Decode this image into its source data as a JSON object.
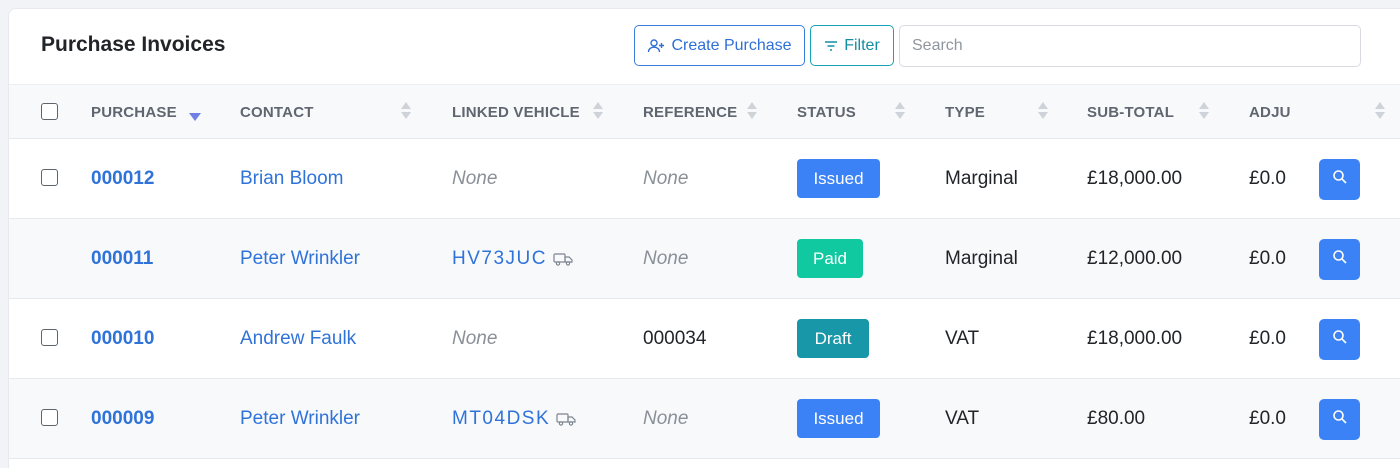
{
  "header": {
    "title": "Purchase Invoices",
    "create_label": "Create Purchase",
    "filter_label": "Filter",
    "search_placeholder": "Search"
  },
  "columns": {
    "purchase": "PURCHASE",
    "contact": "CONTACT",
    "linked_vehicle": "LINKED VEHICLE",
    "reference": "REFERENCE",
    "status": "STATUS",
    "type": "TYPE",
    "subtotal": "SUB-TOTAL",
    "adjustment": "ADJU"
  },
  "sort": {
    "column": "purchase",
    "direction": "desc"
  },
  "colors": {
    "accent": "#3b82f6",
    "link": "#2f73d9",
    "status_issued": "#3b82f6",
    "status_paid": "#10c9a0",
    "status_draft": "#1797a8"
  },
  "rows": [
    {
      "purchase": "000012",
      "contact": "Brian Bloom",
      "vehicle": "None",
      "vehicle_linked": false,
      "reference": "None",
      "reference_set": false,
      "status": "Issued",
      "type": "Marginal",
      "subtotal": "£18,000.00",
      "adjustment": "£0.0",
      "has_checkbox": true
    },
    {
      "purchase": "000011",
      "contact": "Peter Wrinkler",
      "vehicle": "HV73JUC",
      "vehicle_linked": true,
      "reference": "None",
      "reference_set": false,
      "status": "Paid",
      "type": "Marginal",
      "subtotal": "£12,000.00",
      "adjustment": "£0.0",
      "has_checkbox": false
    },
    {
      "purchase": "000010",
      "contact": "Andrew Faulk",
      "vehicle": "None",
      "vehicle_linked": false,
      "reference": "000034",
      "reference_set": true,
      "status": "Draft",
      "type": "VAT",
      "subtotal": "£18,000.00",
      "adjustment": "£0.0",
      "has_checkbox": true
    },
    {
      "purchase": "000009",
      "contact": "Peter Wrinkler",
      "vehicle": "MT04DSK",
      "vehicle_linked": true,
      "reference": "None",
      "reference_set": false,
      "status": "Issued",
      "type": "VAT",
      "subtotal": "£80.00",
      "adjustment": "£0.0",
      "has_checkbox": true
    }
  ]
}
